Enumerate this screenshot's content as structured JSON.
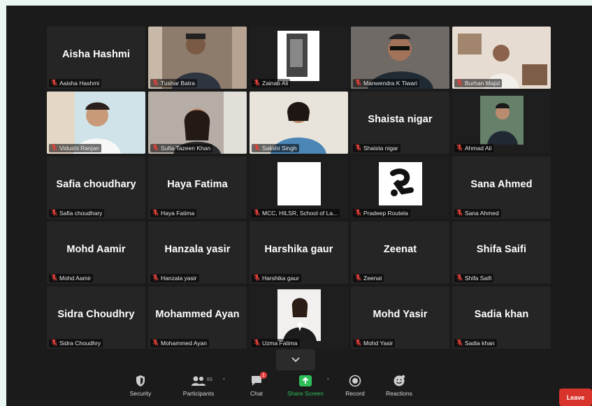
{
  "participants": [
    {
      "big": "Aisha Hashmi",
      "label": "Aaisha Hashmi",
      "video": "none"
    },
    {
      "big": "",
      "label": "Tushar Batra",
      "video": "man-curtain"
    },
    {
      "big": "",
      "label": "Zainab Ali",
      "video": "poster"
    },
    {
      "big": "",
      "label": "Manwendra K Tiwari",
      "video": "man-glasses",
      "speaking": true
    },
    {
      "big": "",
      "label": "Burhan Majid",
      "video": "man-room"
    },
    {
      "big": "",
      "label": "Vidushi Ranjan",
      "video": "girl-light"
    },
    {
      "big": "",
      "label": "Sufia Tazeen Khan",
      "video": "girl-dark"
    },
    {
      "big": "",
      "label": "Sakshi Singh",
      "video": "girl-blue"
    },
    {
      "big": "Shaista nigar",
      "label": "Shaista nigar",
      "video": "none"
    },
    {
      "big": "",
      "label": "Ahmad Ali",
      "video": "man-photo"
    },
    {
      "big": "Safia choudhary",
      "label": "Safia choudhary",
      "video": "none"
    },
    {
      "big": "Haya Fatima",
      "label": "Haya Fatima",
      "video": "none"
    },
    {
      "big": "",
      "label": "MCC, HILSR, School of La...",
      "video": "white-square"
    },
    {
      "big": "",
      "label": "Pradeep Routela",
      "video": "logo"
    },
    {
      "big": "Sana Ahmed",
      "label": "Sana Ahmed",
      "video": "none"
    },
    {
      "big": "Mohd Aamir",
      "label": "Mohd Aamir",
      "video": "none"
    },
    {
      "big": "Hanzala yasir",
      "label": "Hanzala yasir",
      "video": "none"
    },
    {
      "big": "Harshika gaur",
      "label": "Harshika gaur",
      "video": "none"
    },
    {
      "big": "Zeenat",
      "label": "Zeenat",
      "video": "none"
    },
    {
      "big": "Shifa Saifi",
      "label": "Shifa Saifi",
      "video": "none"
    },
    {
      "big": "Sidra Choudhry",
      "label": "Sidra Choudhry",
      "video": "none"
    },
    {
      "big": "Mohammed Ayan",
      "label": "Mohammed Ayan",
      "video": "none"
    },
    {
      "big": "",
      "label": "Uzma Fatima",
      "video": "woman-photo"
    },
    {
      "big": "Mohd Yasir",
      "label": "Mohd Yasir",
      "video": "none"
    },
    {
      "big": "Sadia khan",
      "label": "Sadia khan",
      "video": "none"
    }
  ],
  "toolbar": {
    "security": "Security",
    "participants": "Participants",
    "participants_count": "83",
    "chat": "Chat",
    "chat_badge": "1",
    "share": "Share Screen",
    "record": "Record",
    "reactions": "Reactions",
    "leave": "Leave"
  },
  "colors": {
    "app_bg": "#1b1b1b",
    "tile_bg": "#252525",
    "speaker_outline": "#b6e04a",
    "share_green": "#2fbf5a",
    "leave_red": "#d9342b",
    "mute_red": "#e0413a"
  },
  "icons": {
    "muted": "mic-muted-icon",
    "security": "shield-icon",
    "participants": "people-icon",
    "chat": "chat-bubble-icon",
    "share": "share-screen-icon",
    "record": "record-icon",
    "reactions": "smiley-icon",
    "expand": "chevron-down-icon"
  }
}
